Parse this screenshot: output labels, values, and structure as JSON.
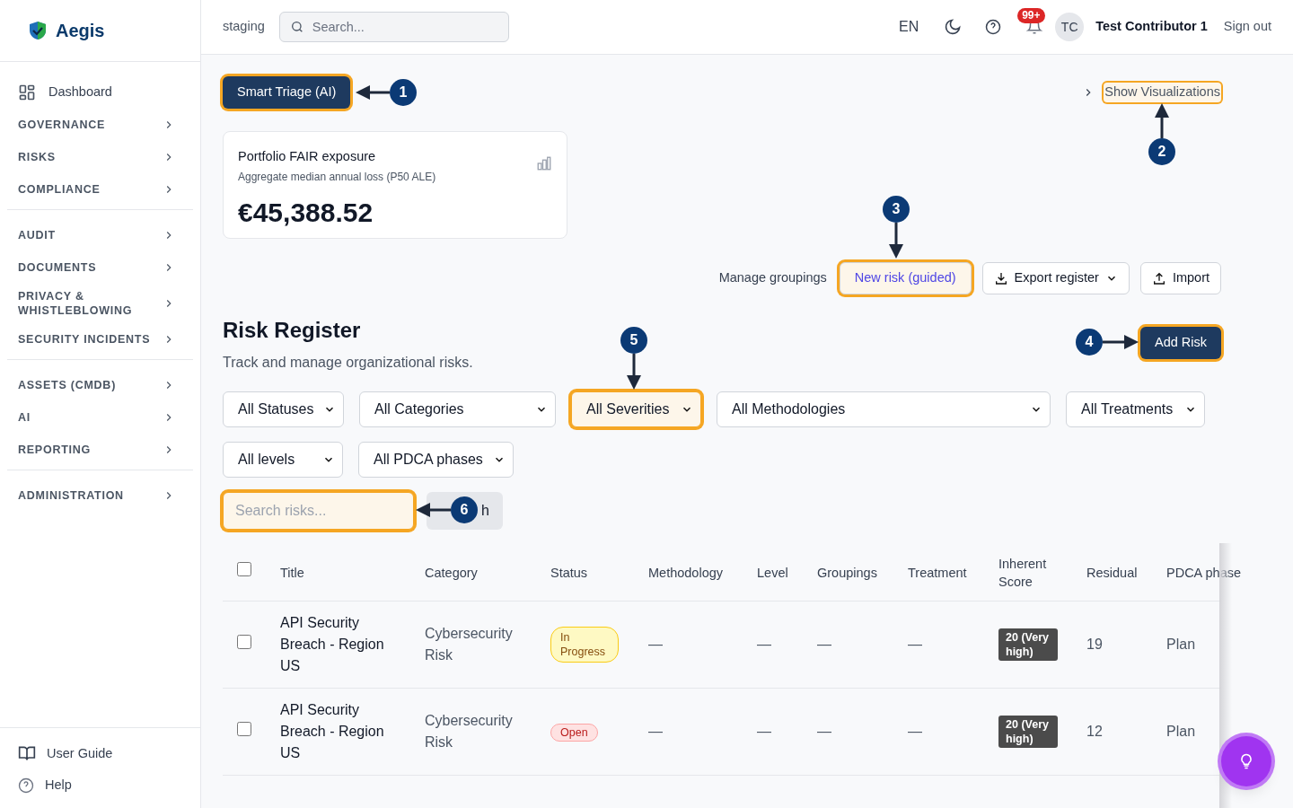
{
  "sidebar": {
    "brand": "Aegis",
    "groups": [
      [
        {
          "label": "Dashboard",
          "kind": "link"
        },
        {
          "label": "GOVERNANCE",
          "kind": "section"
        },
        {
          "label": "RISKS",
          "kind": "section"
        },
        {
          "label": "COMPLIANCE",
          "kind": "section"
        }
      ],
      [
        {
          "label": "AUDIT",
          "kind": "section"
        },
        {
          "label": "DOCUMENTS",
          "kind": "section"
        },
        {
          "label": "PRIVACY & WHISTLEBLOWING",
          "kind": "section"
        },
        {
          "label": "SECURITY INCIDENTS",
          "kind": "section"
        }
      ],
      [
        {
          "label": "ASSETS (CMDB)",
          "kind": "section"
        },
        {
          "label": "AI",
          "kind": "section"
        },
        {
          "label": "REPORTING",
          "kind": "section"
        }
      ],
      [
        {
          "label": "ADMINISTRATION",
          "kind": "section"
        }
      ]
    ],
    "footer": [
      {
        "label": "User Guide",
        "kind": "guide"
      },
      {
        "label": "Help",
        "kind": "help"
      }
    ]
  },
  "header": {
    "environment": "staging",
    "search": {
      "placeholder": "Search..."
    },
    "language": "EN",
    "notifications": "99+",
    "avatar": "TC",
    "user": "Test Contributor 1",
    "sign_out": "Sign out"
  },
  "smart_triage": {
    "label": "Smart Triage (AI)",
    "highlighted": true
  },
  "show_visualizations": {
    "label": "Show Visualizations",
    "highlighted": true
  },
  "fair_card": {
    "title": "Portfolio FAIR exposure",
    "subtitle": "Aggregate median annual loss (P50 ALE)",
    "value": "€45,388.52"
  },
  "actions": [
    {
      "label": "Manage groupings",
      "kind": "text",
      "highlighted": false
    },
    {
      "label": "New risk (guided)",
      "kind": "guided",
      "highlighted": true
    },
    {
      "label": "Export register",
      "kind": "export",
      "highlighted": false
    },
    {
      "label": "Import",
      "kind": "import",
      "highlighted": false
    }
  ],
  "register": {
    "title": "Risk Register",
    "subtitle": "Track and manage organizational risks.",
    "add_button": {
      "label": "Add Risk",
      "highlighted": true
    }
  },
  "filters": [
    [
      {
        "label": "All Statuses",
        "highlighted": false
      },
      {
        "label": "All Categories",
        "highlighted": false
      },
      {
        "label": "All Severities",
        "highlighted": true
      },
      {
        "label": "All Methodologies",
        "highlighted": false
      },
      {
        "label": "All Treatments",
        "highlighted": false
      }
    ],
    [
      {
        "label": "All levels",
        "highlighted": false
      },
      {
        "label": "All PDCA phases",
        "highlighted": false
      }
    ]
  ],
  "search": {
    "placeholder": "Search risks...",
    "highlighted": true,
    "button_visible_text": "h"
  },
  "table": {
    "select_all_checked": false,
    "columns": [
      "Title",
      "Category",
      "Status",
      "Methodology",
      "Level",
      "Groupings",
      "Treatment",
      "Inherent Score",
      "Residual",
      "PDCA phase"
    ],
    "rows": [
      {
        "checked": false,
        "title": "API Security Breach - Region US",
        "category": "Cybersecurity Risk",
        "status": {
          "text": "In Progress",
          "kind": "in_progress"
        },
        "methodology": "—",
        "level": "—",
        "groupings": "—",
        "treatment": "—",
        "inherent": "20 (Very high)",
        "residual": "19",
        "pdca": "Plan"
      },
      {
        "checked": false,
        "title": "API Security Breach - Region US",
        "category": "Cybersecurity Risk",
        "status": {
          "text": "Open",
          "kind": "open"
        },
        "methodology": "—",
        "level": "—",
        "groupings": "—",
        "treatment": "—",
        "inherent": "20 (Very high)",
        "residual": "12",
        "pdca": "Plan"
      }
    ]
  },
  "callouts": [
    {
      "label": "1"
    },
    {
      "label": "2"
    },
    {
      "label": "3"
    },
    {
      "label": "4"
    },
    {
      "label": "5"
    },
    {
      "label": "6"
    }
  ]
}
